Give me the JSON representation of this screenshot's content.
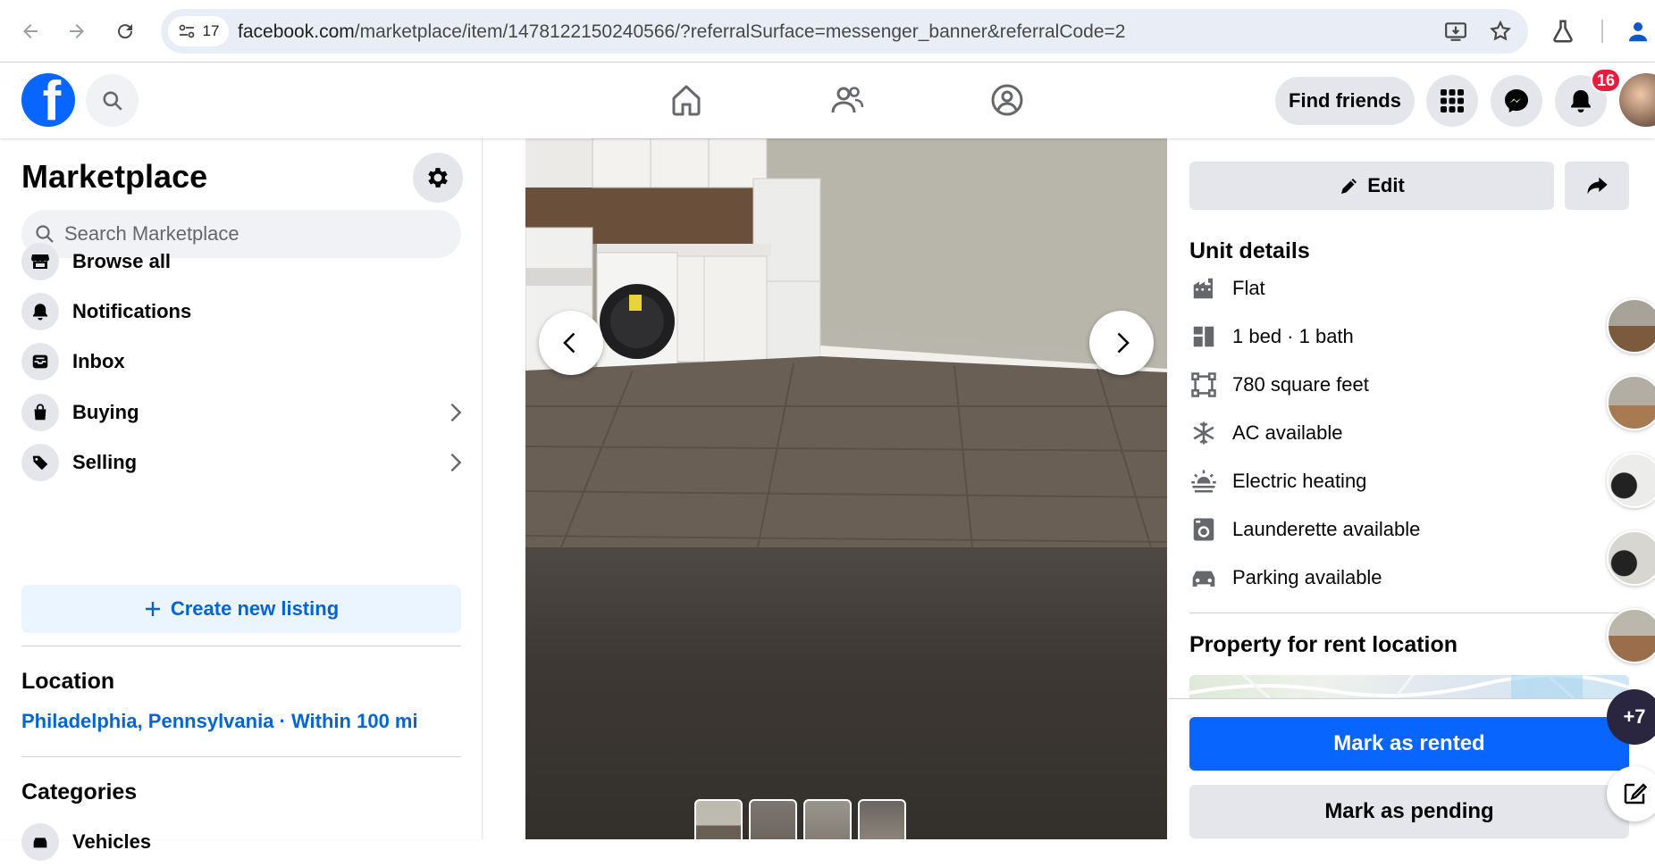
{
  "browser": {
    "site_chip_count": "17",
    "url_host": "facebook.com",
    "url_path": "/marketplace/item/1478122150240566/?referralSurface=messenger_banner&referralCode=2"
  },
  "header": {
    "find_friends_label": "Find friends",
    "notification_count": "16"
  },
  "sidebar": {
    "title": "Marketplace",
    "search_placeholder": "Search Marketplace",
    "items": [
      {
        "label": "Browse all"
      },
      {
        "label": "Notifications"
      },
      {
        "label": "Inbox"
      },
      {
        "label": "Buying"
      },
      {
        "label": "Selling"
      }
    ],
    "create_label": "Create new listing",
    "location_title": "Location",
    "location_value": "Philadelphia, Pennsylvania · Within 100 mi",
    "categories_title": "Categories",
    "first_category": "Vehicles"
  },
  "details": {
    "edit_label": "Edit",
    "unit_title": "Unit details",
    "unit_rows": [
      {
        "icon": "building-icon",
        "text": "Flat"
      },
      {
        "icon": "bed-icon",
        "text": "1 bed · 1 bath"
      },
      {
        "icon": "area-icon",
        "text": "780 square feet"
      },
      {
        "icon": "snowflake-icon",
        "text": "AC available"
      },
      {
        "icon": "heating-icon",
        "text": "Electric heating"
      },
      {
        "icon": "washer-icon",
        "text": "Launderette available"
      },
      {
        "icon": "car-icon",
        "text": "Parking available"
      }
    ],
    "location_title": "Property for rent location",
    "mark_rented_label": "Mark as rented",
    "mark_pending_label": "Mark as pending"
  },
  "chat": {
    "more_count": "+7"
  },
  "colors": {
    "brand_blue": "#0866ff",
    "link_blue": "#0064d1",
    "badge_red": "#e41e3f"
  }
}
